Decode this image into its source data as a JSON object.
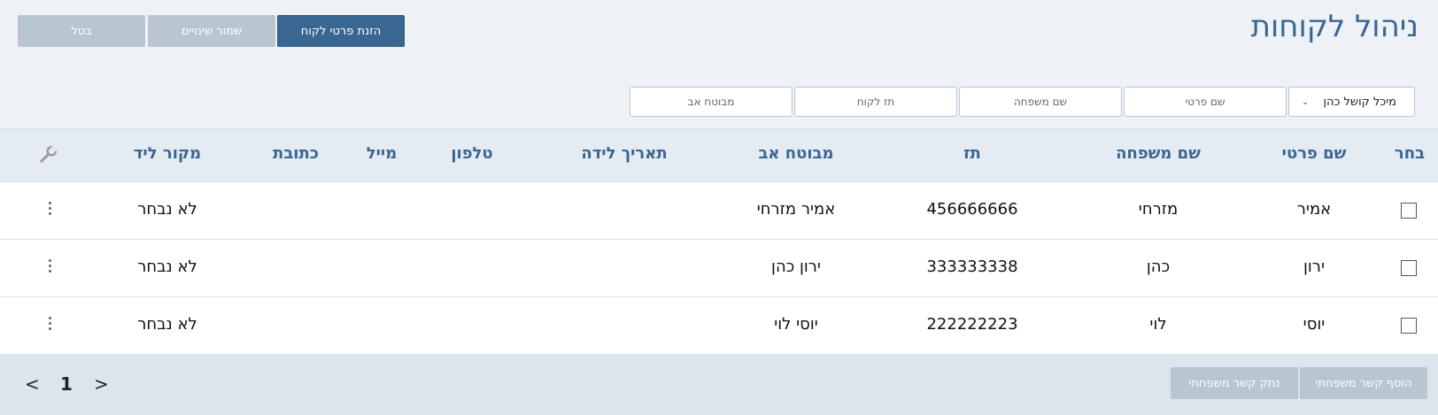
{
  "page": {
    "title": "ניהול לקוחות"
  },
  "toolbar": {
    "add_customer_label": "הזנת פרטי לקוח",
    "save_label": "שמור שינויים",
    "cancel_label": "בטל"
  },
  "filters": {
    "agent_selected": "מיכל קושל כהן",
    "first_name_placeholder": "שם פרטי",
    "last_name_placeholder": "שם משפחה",
    "id_placeholder": "תז לקוח",
    "father_insured_placeholder": "מבוטח אב"
  },
  "table": {
    "headers": {
      "select": "בחר",
      "first_name": "שם פרטי",
      "last_name": "שם משפחה",
      "id": "תז",
      "father_insured": "מבוטח אב",
      "birth_date": "תאריך לידה",
      "phone": "טלפון",
      "email": "מייל",
      "address": "כתובת",
      "lead_source": "מקור ליד"
    },
    "rows": [
      {
        "first_name": "אמיר",
        "last_name": "מזרחי",
        "id": "456666666",
        "father_insured": "אמיר מזרחי",
        "birth_date": "",
        "phone": "",
        "email": "",
        "address": "",
        "lead_source": "לא נבחר"
      },
      {
        "first_name": "ירון",
        "last_name": "כהן",
        "id": "333333338",
        "father_insured": "ירון כהן",
        "birth_date": "",
        "phone": "",
        "email": "",
        "address": "",
        "lead_source": "לא נבחר"
      },
      {
        "first_name": "יוסי",
        "last_name": "לוי",
        "id": "222222223",
        "father_insured": "יוסי לוי",
        "birth_date": "",
        "phone": "",
        "email": "",
        "address": "",
        "lead_source": "לא נבחר"
      }
    ]
  },
  "footer": {
    "add_family_link_label": "הוסף קשר משפחתי",
    "remove_family_link_label": "נתק קשר משפחתי",
    "current_page": "1",
    "prev_symbol": "<",
    "next_symbol": ">"
  },
  "icons": {
    "settings": "wrench-icon",
    "row_menu": "kebab-menu-icon",
    "dropdown": "chevron-down-icon"
  },
  "colors": {
    "accent": "#3a6791",
    "header_bg": "#e4ebf2",
    "disabled": "#b9c6d1"
  }
}
